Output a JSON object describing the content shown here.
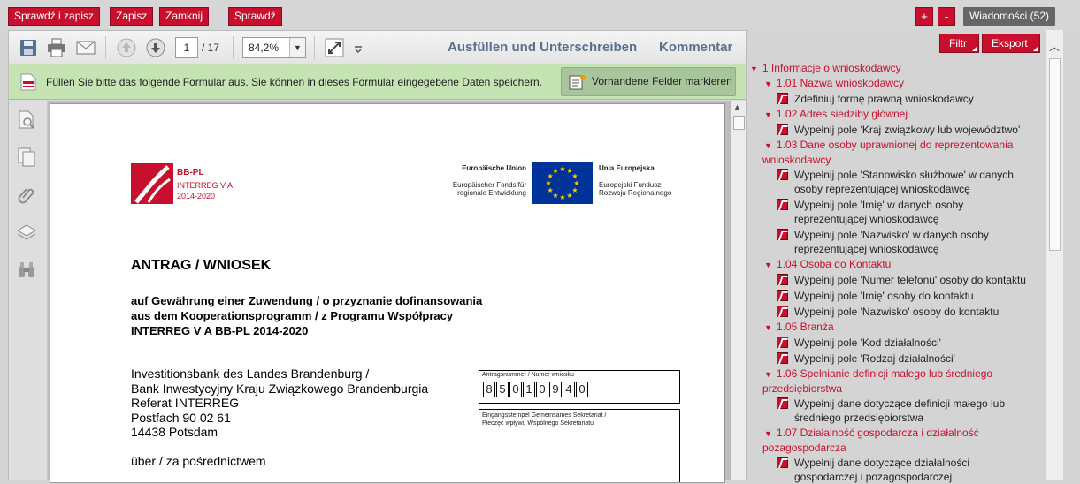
{
  "topbar": {
    "check_save": "Sprawdź i zapisz",
    "save": "Zapisz",
    "close": "Zamknij",
    "check": "Sprawdź",
    "plus": "+",
    "minus": "-",
    "messages": "Wiadomości (52)"
  },
  "pdf_toolbar": {
    "page_current": "1",
    "page_total": "/ 17",
    "zoom": "84,2%",
    "fill_sign": "Ausfüllen und Unterschreiben",
    "comment": "Kommentar"
  },
  "form_bar": {
    "message": "Füllen Sie bitte das folgende Formular aus. Sie können in dieses Formular eingegebene Daten speichern.",
    "highlight_button": "Vorhandene Felder markieren"
  },
  "document": {
    "logo_title": "BB-PL",
    "logo_sub1": "INTERREG V A",
    "logo_sub2": "2014-2020",
    "eu_de_title": "Europäische Union",
    "eu_de_line1": "Europäischer Fonds für",
    "eu_de_line2": "regionale Entwicklung",
    "eu_pl_title": "Unia Europejska",
    "eu_pl_line1": "Europejski Fundusz",
    "eu_pl_line2": "Rozwoju Regionalnego",
    "heading": "ANTRAG / WNIOSEK",
    "sub1": "auf Gewährung einer Zuwendung / o przyznanie dofinansowania",
    "sub2": "aus dem Kooperationsprogramm / z Programu Współpracy",
    "sub3": "INTERREG V A BB-PL 2014-2020",
    "addr1": "Investitionsbank des Landes Brandenburg /",
    "addr2": "Bank Inwestycyjny Kraju Związkowego Brandenburgia",
    "addr3": "Referat INTERREG",
    "addr4": "Postfach 90 02 61",
    "addr5": "14438 Potsdam",
    "addr6": "über / za pośrednictwem",
    "appno_label": "Antragsnummer / Numer wniosku",
    "appno_digits": [
      "8",
      "5",
      "0",
      "1",
      "0",
      "9",
      "4",
      "0"
    ],
    "stamp_label1": "Eingangsstempel Gemeinsames Sekretariat /",
    "stamp_label2": "Pieczęć wpływu Wspólnego Sekretariatu"
  },
  "right_panel": {
    "filter": "Filtr",
    "export": "Eksport",
    "tree": [
      {
        "kind": "sec",
        "level": 0,
        "lines": [
          "1    Informacje o wnioskodawcy"
        ]
      },
      {
        "kind": "sec",
        "level": 1,
        "lines": [
          "1.01  Nazwa wnioskodawcy"
        ]
      },
      {
        "kind": "item",
        "lines": [
          "Zdefiniuj formę prawną wnioskodawcy"
        ]
      },
      {
        "kind": "sec",
        "level": 1,
        "lines": [
          "1.02  Adres siedziby głównej"
        ]
      },
      {
        "kind": "item",
        "lines": [
          "Wypełnij pole 'Kraj związkowy lub województwo'"
        ]
      },
      {
        "kind": "sec",
        "level": 1,
        "lines": [
          "1.03  Dane osoby uprawnionej do reprezentowania",
          "wnioskodawcy"
        ]
      },
      {
        "kind": "item",
        "lines": [
          "Wypełnij pole 'Stanowisko służbowe'  w danych",
          "osoby reprezentującej wnioskodawcę"
        ]
      },
      {
        "kind": "item",
        "lines": [
          "Wypełnij pole 'Imię'   w danych osoby",
          "reprezentującej wnioskodawcę"
        ]
      },
      {
        "kind": "item",
        "lines": [
          "Wypełnij pole 'Nazwisko'   w danych osoby",
          "reprezentującej wnioskodawcę"
        ]
      },
      {
        "kind": "sec",
        "level": 1,
        "lines": [
          "1.04 Osoba do Kontaktu"
        ]
      },
      {
        "kind": "item",
        "lines": [
          "Wypełnij pole 'Numer telefonu'  osoby do kontaktu"
        ]
      },
      {
        "kind": "item",
        "lines": [
          "Wypełnij pole 'Imię'  osoby do kontaktu"
        ]
      },
      {
        "kind": "item",
        "lines": [
          "Wypełnij pole 'Nazwisko'  osoby do kontaktu"
        ]
      },
      {
        "kind": "sec",
        "level": 1,
        "lines": [
          "1.05 Branża"
        ]
      },
      {
        "kind": "item",
        "lines": [
          "Wypełnij pole 'Kod działalności'"
        ]
      },
      {
        "kind": "item",
        "lines": [
          "Wypełnij pole 'Rodzaj działalności'"
        ]
      },
      {
        "kind": "sec",
        "level": 1,
        "lines": [
          "1.06  Spełnianie definicji małego lub średniego",
          "przedsiębiorstwa"
        ]
      },
      {
        "kind": "item",
        "lines": [
          "Wypełnij dane dotyczące definicji małego lub",
          "średniego przedsiębiorstwa"
        ]
      },
      {
        "kind": "sec",
        "level": 1,
        "lines": [
          "1.07  Działalność gospodarcza i działalność",
          "pozagospodarcza"
        ]
      },
      {
        "kind": "item",
        "lines": [
          "Wypełnij dane dotyczące działalności",
          "gospodarczej i pozagospodarczej"
        ]
      }
    ]
  },
  "colors": {
    "accent": "#c8102e",
    "form_bar": "#c5e3b3",
    "eu_blue": "#003399",
    "eu_star": "#ffcc00"
  }
}
